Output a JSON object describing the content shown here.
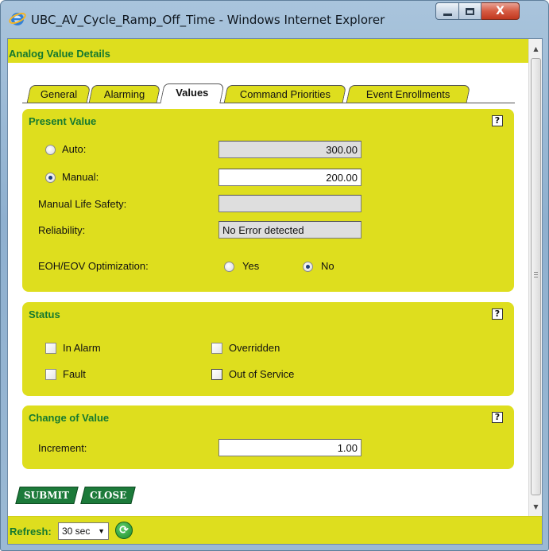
{
  "window": {
    "title": "UBC_AV_Cycle_Ramp_Off_Time - Windows Internet Explorer",
    "close_glyph": "X"
  },
  "page": {
    "header": "Analog Value Details"
  },
  "tabs": [
    {
      "label": "General",
      "active": false
    },
    {
      "label": "Alarming",
      "active": false
    },
    {
      "label": "Values",
      "active": true
    },
    {
      "label": "Command Priorities",
      "active": false
    },
    {
      "label": "Event Enrollments",
      "active": false
    }
  ],
  "present_value": {
    "title": "Present Value",
    "help": "?",
    "auto_label": "Auto:",
    "auto_value": "300.00",
    "manual_label": "Manual:",
    "manual_value": "200.00",
    "manual_life_safety_label": "Manual Life Safety:",
    "manual_life_safety_value": "",
    "reliability_label": "Reliability:",
    "reliability_value": "No Error detected",
    "eoh_label": "EOH/EOV Optimization:",
    "eoh_yes": "Yes",
    "eoh_no": "No",
    "selected_mode": "manual",
    "eoh_selected": "no"
  },
  "status": {
    "title": "Status",
    "help": "?",
    "in_alarm": "In Alarm",
    "overridden": "Overridden",
    "fault": "Fault",
    "out_of_service": "Out of Service"
  },
  "change_of_value": {
    "title": "Change of Value",
    "help": "?",
    "increment_label": "Increment:",
    "increment_value": "1.00"
  },
  "buttons": {
    "submit": "SUBMIT",
    "close": "CLOSE"
  },
  "footer": {
    "refresh_label": "Refresh:",
    "refresh_value": "30 sec",
    "refresh_icon": "refresh-icon"
  },
  "colors": {
    "panel": "#dede1e",
    "header_text": "#15792f",
    "button": "#1c7a3a"
  }
}
